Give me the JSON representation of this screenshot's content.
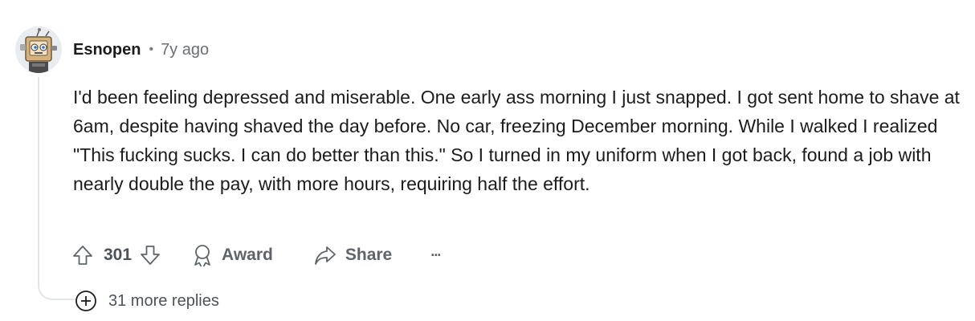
{
  "comment": {
    "username": "Esnopen",
    "separator": "•",
    "time": "7y ago",
    "body": "I'd been feeling depressed and miserable. One early ass morning I just snapped. I got sent home to shave at 6am, despite having shaved the day before. No car, freezing December morning. While I walked I realized \"This fucking sucks. I can do better than this.\" So I turned in my uniform when I got back, found a job with nearly double the pay, with more hours, requiring half the effort."
  },
  "actions": {
    "score": "301",
    "award_label": "Award",
    "share_label": "Share",
    "more_label": "···"
  },
  "replies": {
    "more_label": "31 more replies"
  },
  "icons": {
    "upvote": "arrow-up-icon",
    "downvote": "arrow-down-icon",
    "award": "award-icon",
    "share": "share-icon",
    "more": "ellipsis-icon",
    "expand": "plus-circle-icon"
  },
  "colors": {
    "text": "#1c1c1c",
    "muted": "#5f6468",
    "thread_line": "#e3e6e8",
    "avatar_bg": "#e9edf1"
  }
}
